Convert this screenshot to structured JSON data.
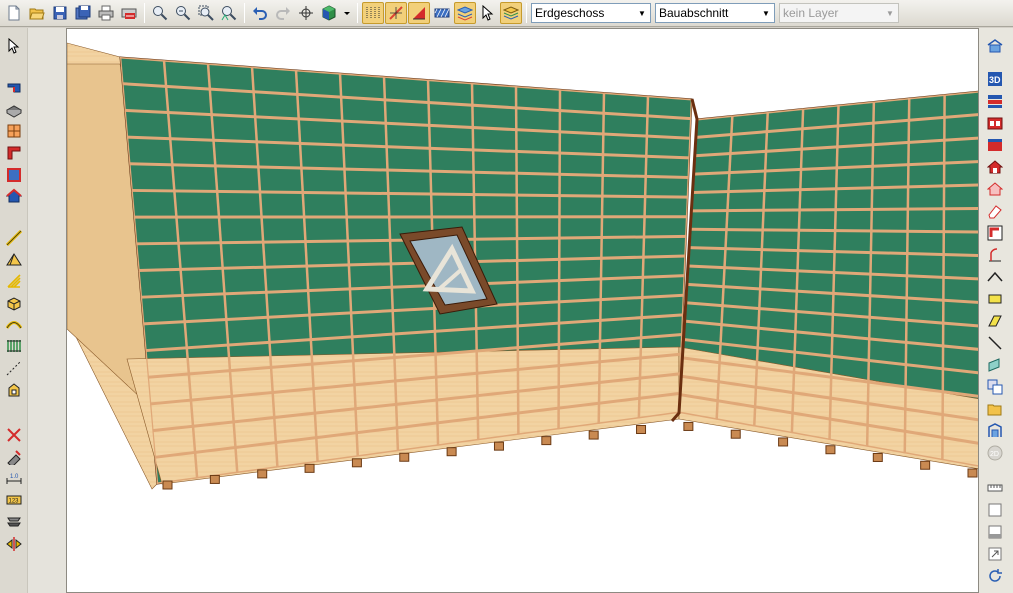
{
  "toolbar": {
    "buttons": [
      {
        "name": "new-document-icon"
      },
      {
        "name": "open-folder-icon"
      },
      {
        "name": "save-icon"
      },
      {
        "name": "save-as-icon"
      },
      {
        "name": "print-icon"
      },
      {
        "name": "export-pdf-icon"
      },
      {
        "name": "zoom-in-icon"
      },
      {
        "name": "zoom-out-icon"
      },
      {
        "name": "zoom-window-icon"
      },
      {
        "name": "zoom-all-icon"
      },
      {
        "name": "undo-icon"
      },
      {
        "name": "redo-icon"
      },
      {
        "name": "pan-icon"
      },
      {
        "name": "3d-view-icon"
      },
      {
        "name": "grid-snap-icon"
      },
      {
        "name": "point-snap-icon"
      },
      {
        "name": "angle-snap-icon"
      },
      {
        "name": "hatching-icon"
      },
      {
        "name": "layer-snap-icon"
      },
      {
        "name": "select-pointer-icon"
      },
      {
        "name": "layer-stack-icon"
      }
    ],
    "floor_select": {
      "value": "Erdgeschoss"
    },
    "section_select": {
      "value": "Bauabschnitt"
    },
    "layer_select": {
      "value": "kein Layer"
    }
  },
  "colors": {
    "roof_green": "#2f7f5e",
    "batten": "#e0a878",
    "wood": "#f2d3a2",
    "active_tool": "#f2d07a"
  }
}
